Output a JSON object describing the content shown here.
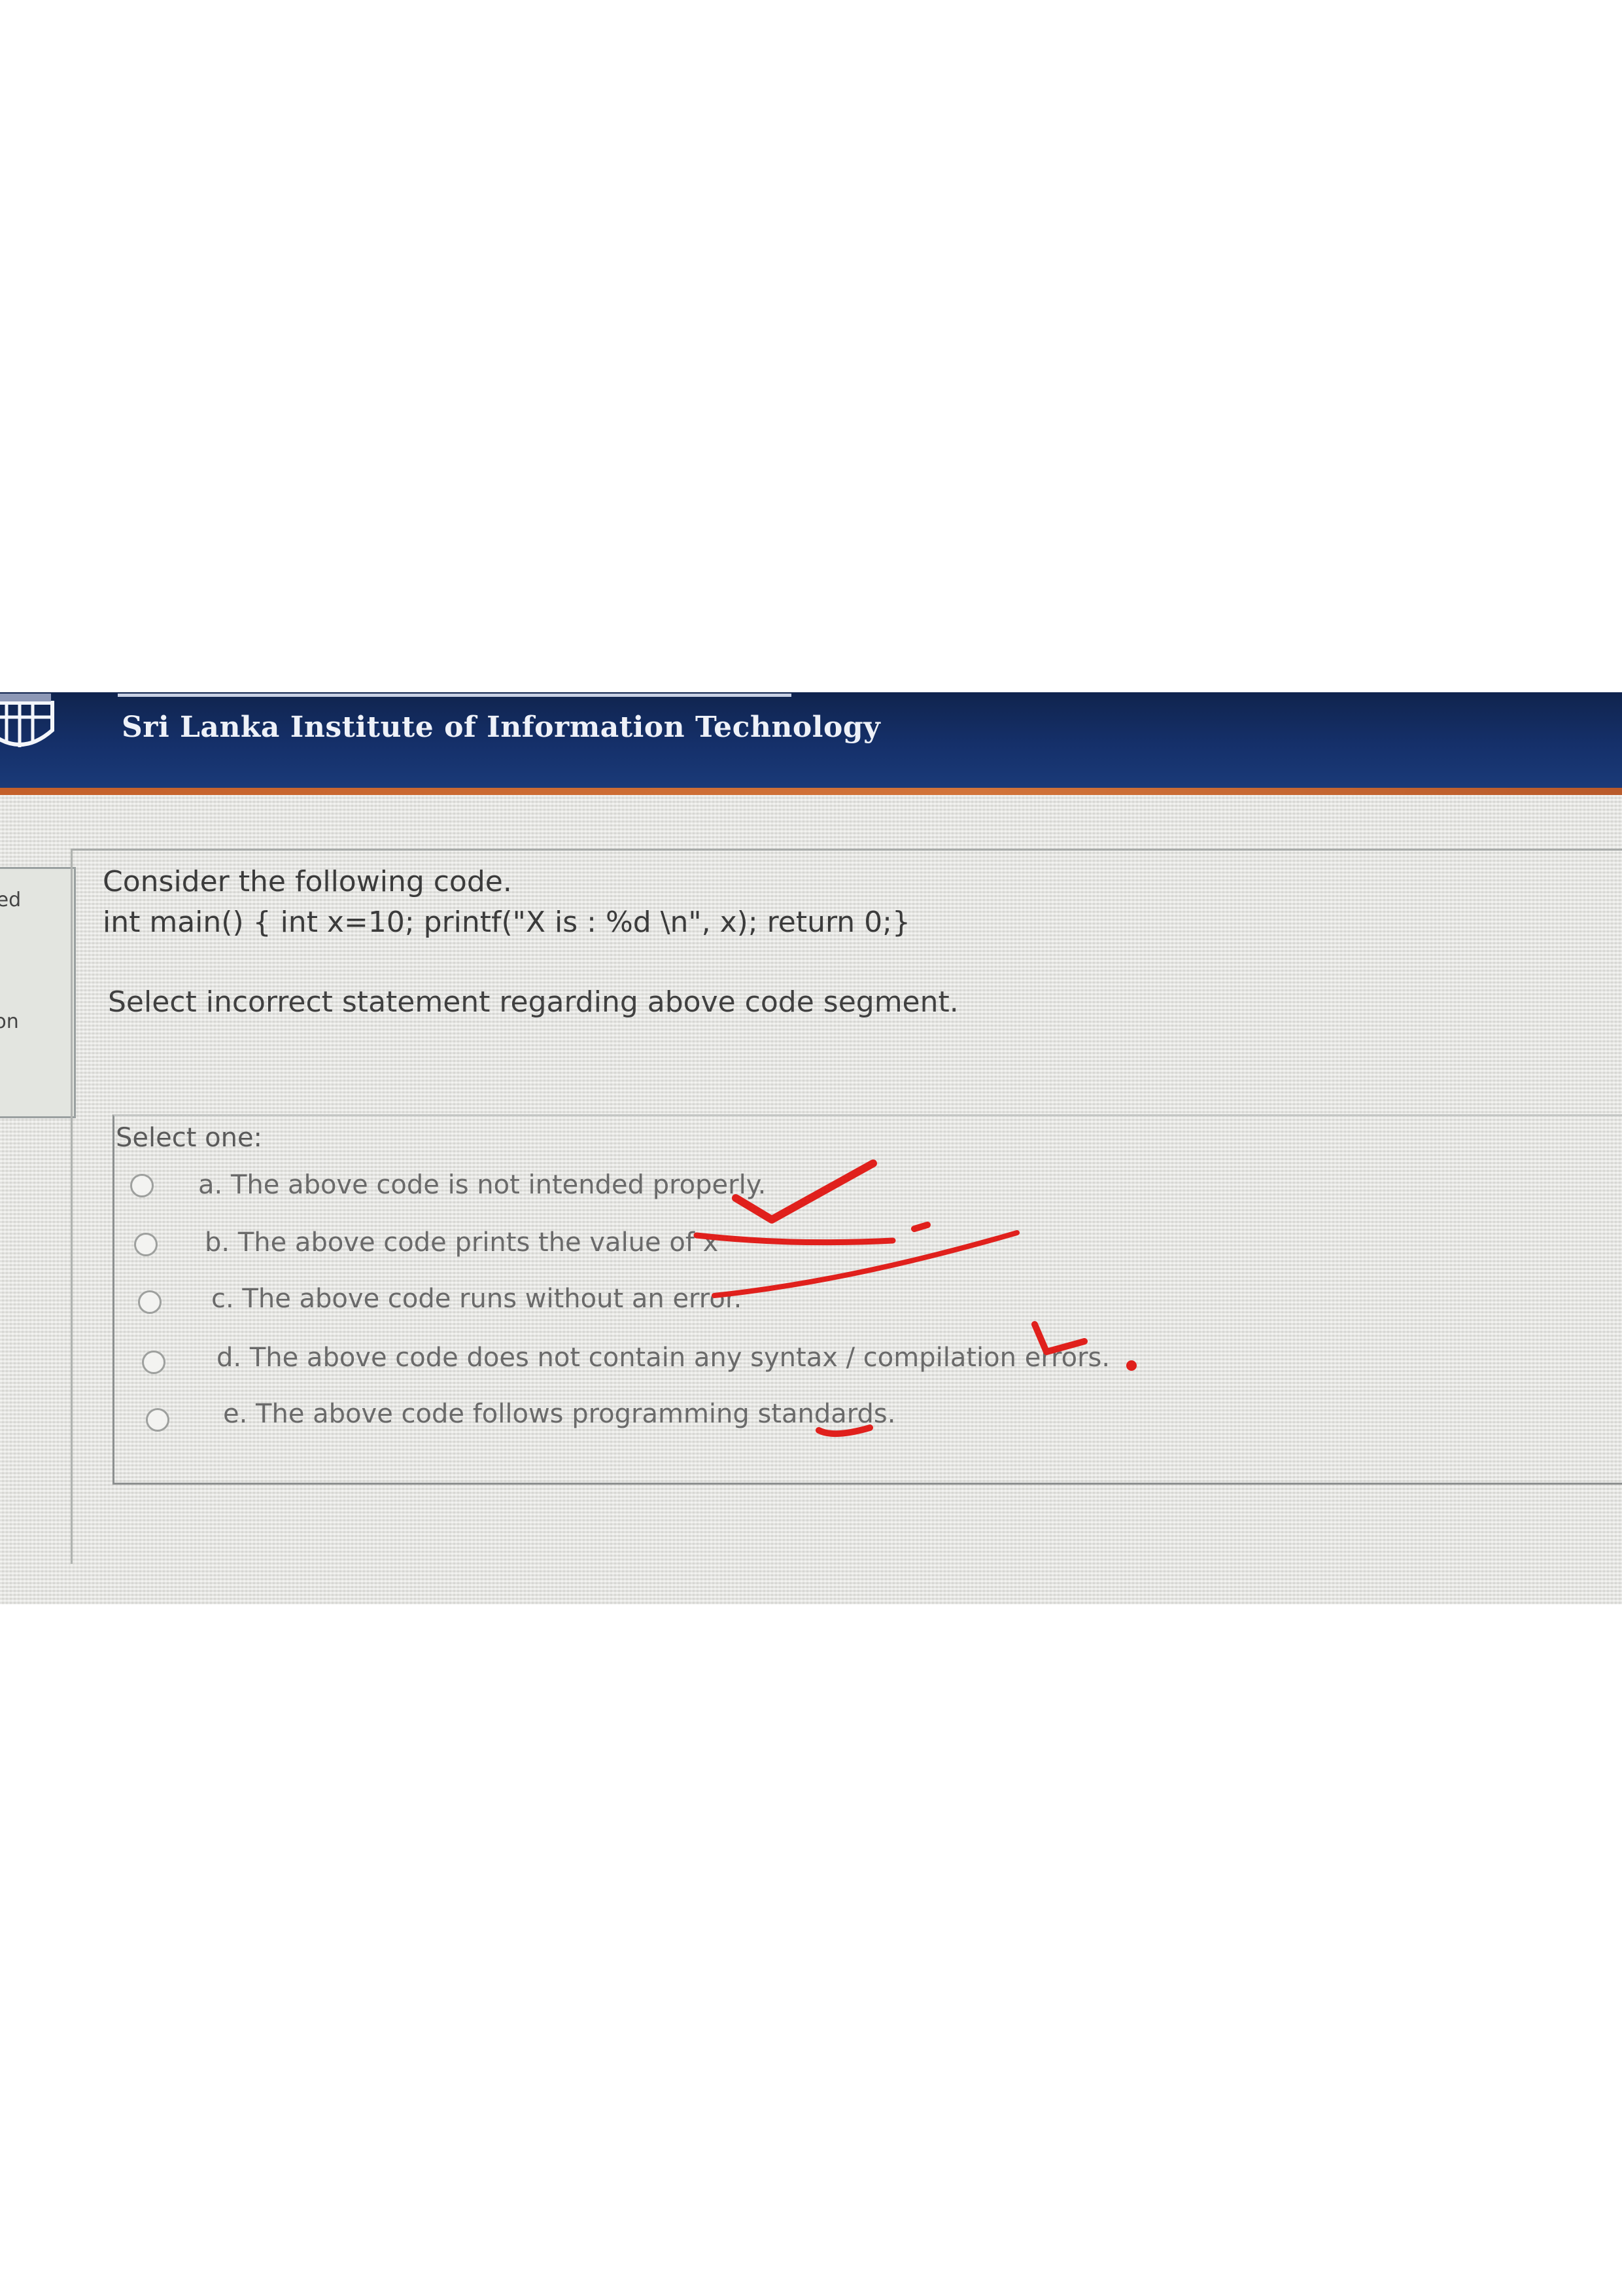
{
  "header": {
    "institution": "Sri Lanka Institute of Information Technology"
  },
  "sidebar": {
    "fragment_top": "red",
    "fragment_bottom": "ion"
  },
  "question": {
    "intro": "Consider the following code.",
    "code": "int main() { int x=10; printf(\"X is : %d \\n\", x); return 0;}",
    "prompt": "Select incorrect statement regarding above code segment.",
    "select_label": "Select one:",
    "options": [
      {
        "label": "a. The above code is not intended properly."
      },
      {
        "label": "b. The above code prints the value of x"
      },
      {
        "label": "c. The above code runs without an error."
      },
      {
        "label": "d. The above code does not contain any syntax / compilation errors."
      },
      {
        "label": "e. The above code follows programming standards."
      }
    ]
  },
  "colors": {
    "header_bg": "#15306a",
    "accent_rule": "#c4602a",
    "annotation_ink": "#e0201c"
  }
}
